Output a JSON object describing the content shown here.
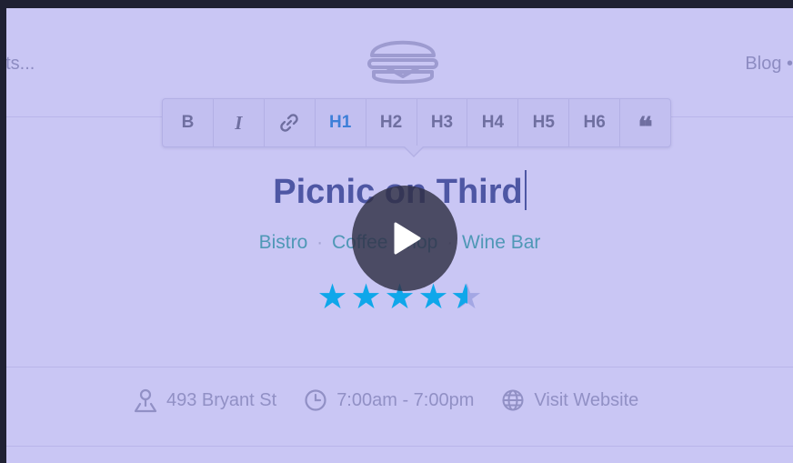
{
  "nav": {
    "left_text": "nts...",
    "right_text": "Blog •"
  },
  "toolbar": {
    "buttons": [
      {
        "label": "B"
      },
      {
        "label": "I"
      },
      {
        "label": "link-icon"
      },
      {
        "label": "H1"
      },
      {
        "label": "H2"
      },
      {
        "label": "H3"
      },
      {
        "label": "H4"
      },
      {
        "label": "H5"
      },
      {
        "label": "H6"
      },
      {
        "label": "❝"
      }
    ],
    "active": "H1"
  },
  "listing": {
    "title": "Picnic on Third",
    "categories": [
      "Bistro",
      "Coffee Shop",
      "Wine Bar"
    ],
    "separator": "·",
    "rating": 4.5,
    "rating_max": 5
  },
  "info": {
    "address": "493 Bryant St",
    "hours": "7:00am - 7:00pm",
    "website_label": "Visit Website"
  },
  "colors": {
    "accent": "#0fa7ea",
    "active_heading": "#3d7fd8",
    "title": "#4e57a4",
    "category": "#4f98b6",
    "overlay": "#c9c6f4"
  },
  "icons": [
    "burger-logo-icon",
    "link-icon",
    "quote-icon",
    "play-icon",
    "location-pin-icon",
    "clock-icon",
    "globe-icon"
  ]
}
